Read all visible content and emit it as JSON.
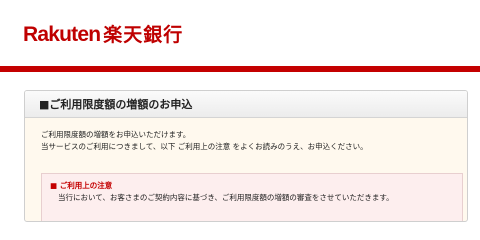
{
  "brand": {
    "logo_latin": "Rakuten",
    "logo_japanese": "楽天銀行",
    "color": "#bf0000"
  },
  "panel": {
    "heading": "■ご利用限度額の増額のお申込",
    "intro_lines": [
      "ご利用限度額の増額をお申込いただけます。",
      "当サービスのご利用につきまして、以下 ご利用上の注意 をよくお読みのうえ、お申込ください。"
    ]
  },
  "notice": {
    "title": "■ ご利用上の注意",
    "text": "当行において、お客さまのご契約内容に基づき、ご利用限度額の増額の審査をさせていただきます。"
  },
  "colors": {
    "accent_red": "#c40000",
    "panel_bg": "#fff9ee",
    "notice_bg": "#fdeeee"
  }
}
